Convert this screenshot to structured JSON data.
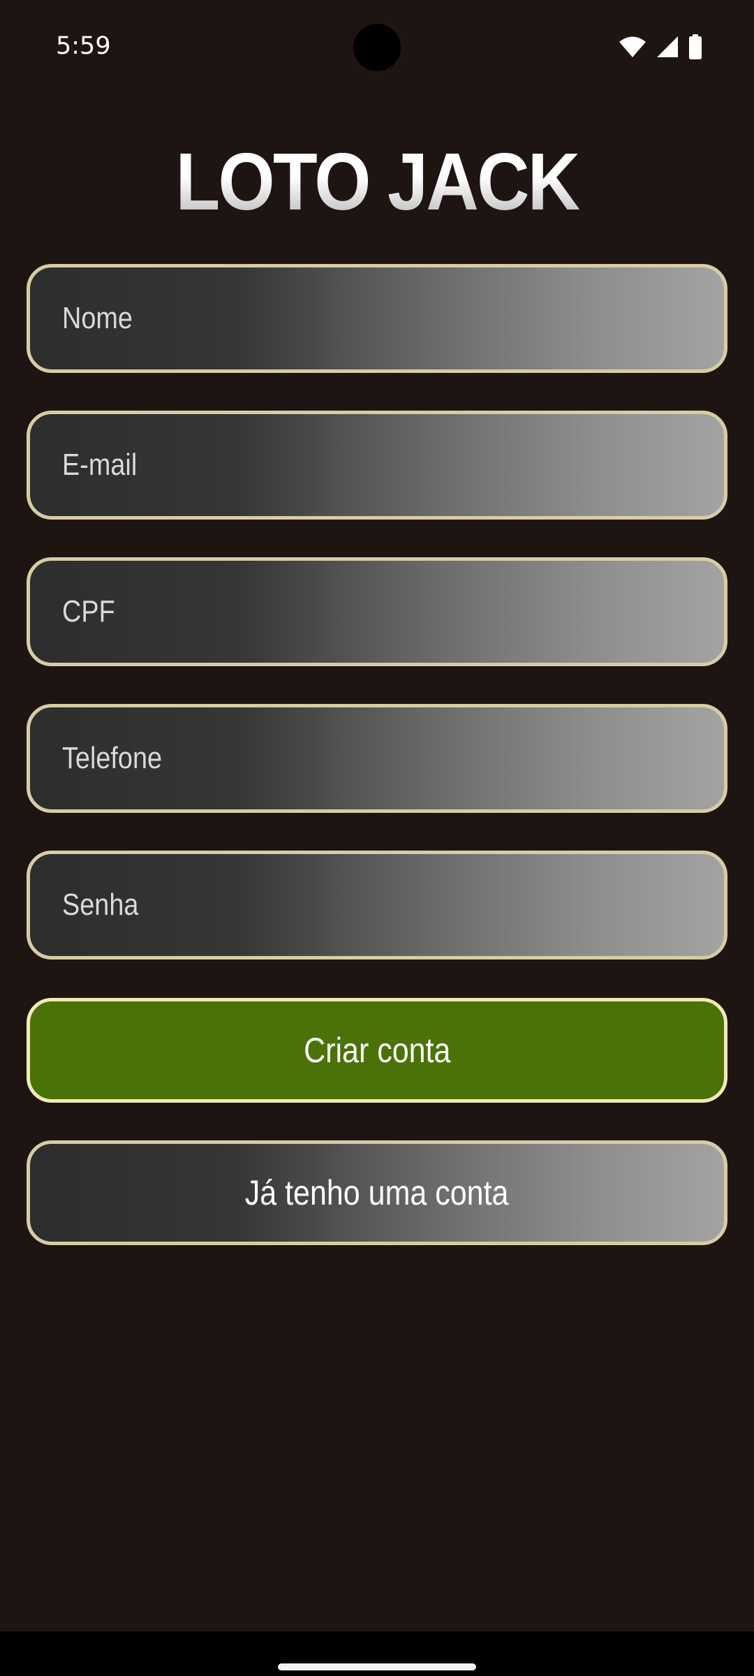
{
  "status_bar": {
    "time": "5:59",
    "icons": [
      "wifi-icon",
      "cellular-signal-icon",
      "battery-icon"
    ]
  },
  "app": {
    "title": "LOTO JACK"
  },
  "form": {
    "fields": [
      {
        "name": "nome",
        "placeholder": "Nome"
      },
      {
        "name": "email",
        "placeholder": "E-mail"
      },
      {
        "name": "cpf",
        "placeholder": "CPF"
      },
      {
        "name": "telefone",
        "placeholder": "Telefone"
      },
      {
        "name": "senha",
        "placeholder": "Senha"
      }
    ]
  },
  "actions": {
    "create_account_label": "Criar conta",
    "have_account_label": "Já tenho uma conta"
  },
  "colors": {
    "background": "#1e1513",
    "field_border": "#d8cca4",
    "primary_button": "#4a7208",
    "primary_button_border": "#f2eab8"
  }
}
